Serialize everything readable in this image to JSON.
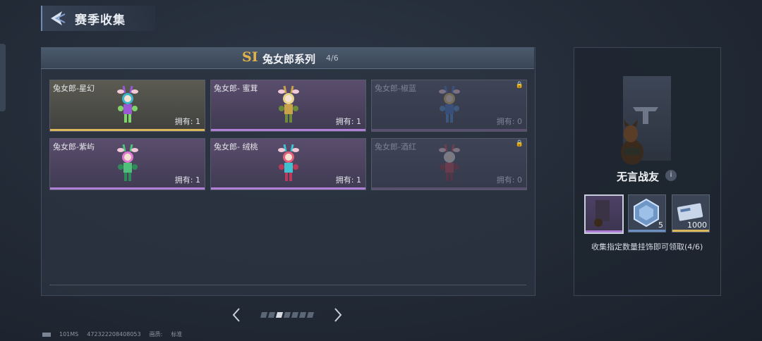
{
  "header": {
    "title": "赛季收集",
    "back_icon": "back-arrow-icon"
  },
  "series": {
    "season_label": "SI",
    "title": "兔女郎系列",
    "progress": "4/6"
  },
  "items": [
    {
      "name": "兔女郎-星幻",
      "owned": "拥有: 1",
      "state": "gold"
    },
    {
      "name": "兔女郎- 蜜茸",
      "owned": "拥有: 1",
      "state": "purple"
    },
    {
      "name": "兔女郎-椒蓝",
      "owned": "拥有: 0",
      "state": "locked"
    },
    {
      "name": "兔女郎-紫屿",
      "owned": "拥有: 1",
      "state": "purple"
    },
    {
      "name": "兔女郎- 绒桃",
      "owned": "拥有: 1",
      "state": "purple"
    },
    {
      "name": "兔女郎-酒红",
      "owned": "拥有: 0",
      "state": "locked"
    }
  ],
  "pager": {
    "total_pages": 7,
    "current_page": 3
  },
  "footer": {
    "server": "101MS",
    "uid": "472322208408053",
    "quality_label": "画质:",
    "quality_value": "标准"
  },
  "reward": {
    "name": "无言战友",
    "slots": [
      {
        "label": "",
        "qty": ""
      },
      {
        "label": "",
        "qty": "5"
      },
      {
        "label": "",
        "qty": "1000"
      }
    ],
    "claim_text": "收集指定数量挂饰即可领取(4/6)"
  },
  "colors": {
    "gold": "#d9b75a",
    "purple": "#b07fd6",
    "accent_blue": "#6f8bb0"
  }
}
